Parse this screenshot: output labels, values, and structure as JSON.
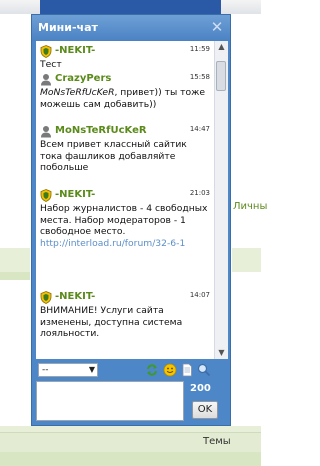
{
  "colors": {
    "chat_bg": "#4d87c7",
    "nick_green": "#5a8a1a",
    "link": "#5c8fc9"
  },
  "background": {
    "right_text": "Личны",
    "bottom_text": "Темы"
  },
  "chat": {
    "title": "Мини-чат",
    "close_icon": "close-icon",
    "messages": [
      {
        "icon": "shield-icon",
        "nick": "-NEKIT-",
        "time": "11:59",
        "text": "Тест"
      },
      {
        "icon": "user-icon",
        "nick": "CrazyPers",
        "time": "15:58",
        "text_italic": "MoNsTeRfUcKeR",
        "text": ", привет)) ты тоже можешь сам добавить))"
      },
      {
        "icon": "user-icon",
        "nick": "MoNsTeRfUcKeR",
        "time": "14:47",
        "text": "Всем привет классный сайтик тока фашликов добавляйте побольше"
      },
      {
        "icon": "shield-icon",
        "nick": "-NEKIT-",
        "time": "21:03",
        "text": "Набор журналистов - 4 свободных места. Набор модераторов - 1 свободное место.",
        "link": "http://interload.ru/forum/32-6-1"
      },
      {
        "icon": "shield-icon",
        "nick": "-NEKIT-",
        "time": "14:07",
        "text": "ВНИМАНИЕ! Услуги сайта изменены, доступна система лояльности."
      }
    ],
    "select_value": "--",
    "counter": "200",
    "ok_label": "OK"
  }
}
